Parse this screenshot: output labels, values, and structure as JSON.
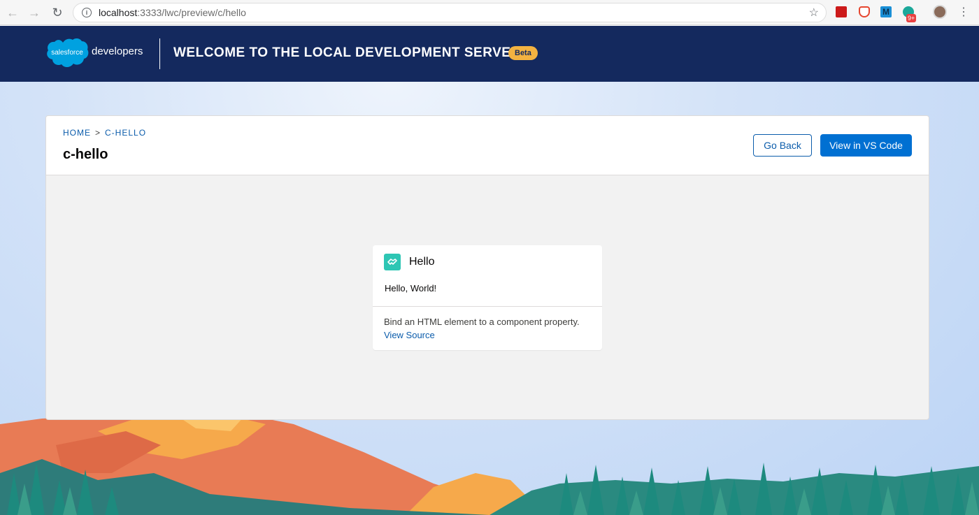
{
  "browser": {
    "url_host": "localhost",
    "url_rest": ":3333/lwc/preview/c/hello",
    "extension_badge": "9+"
  },
  "header": {
    "logo_text": "salesforce",
    "brand_suffix": "developers",
    "title": "Welcome to the Local Development Server",
    "badge": "Beta"
  },
  "page": {
    "breadcrumb": [
      "HOME",
      ">",
      "C-HELLO"
    ],
    "title": "c-hello",
    "buttons": {
      "back": "Go Back",
      "vscode": "View in VS Code"
    }
  },
  "component": {
    "title": "Hello",
    "body": "Hello, World!",
    "description": "Bind an HTML element to a component property.",
    "link": "View Source"
  },
  "colors": {
    "header_bg": "#14295e",
    "brand_blue": "#0070d2",
    "beta_badge": "#f3b241",
    "component_icon": "#2ec6b4"
  }
}
